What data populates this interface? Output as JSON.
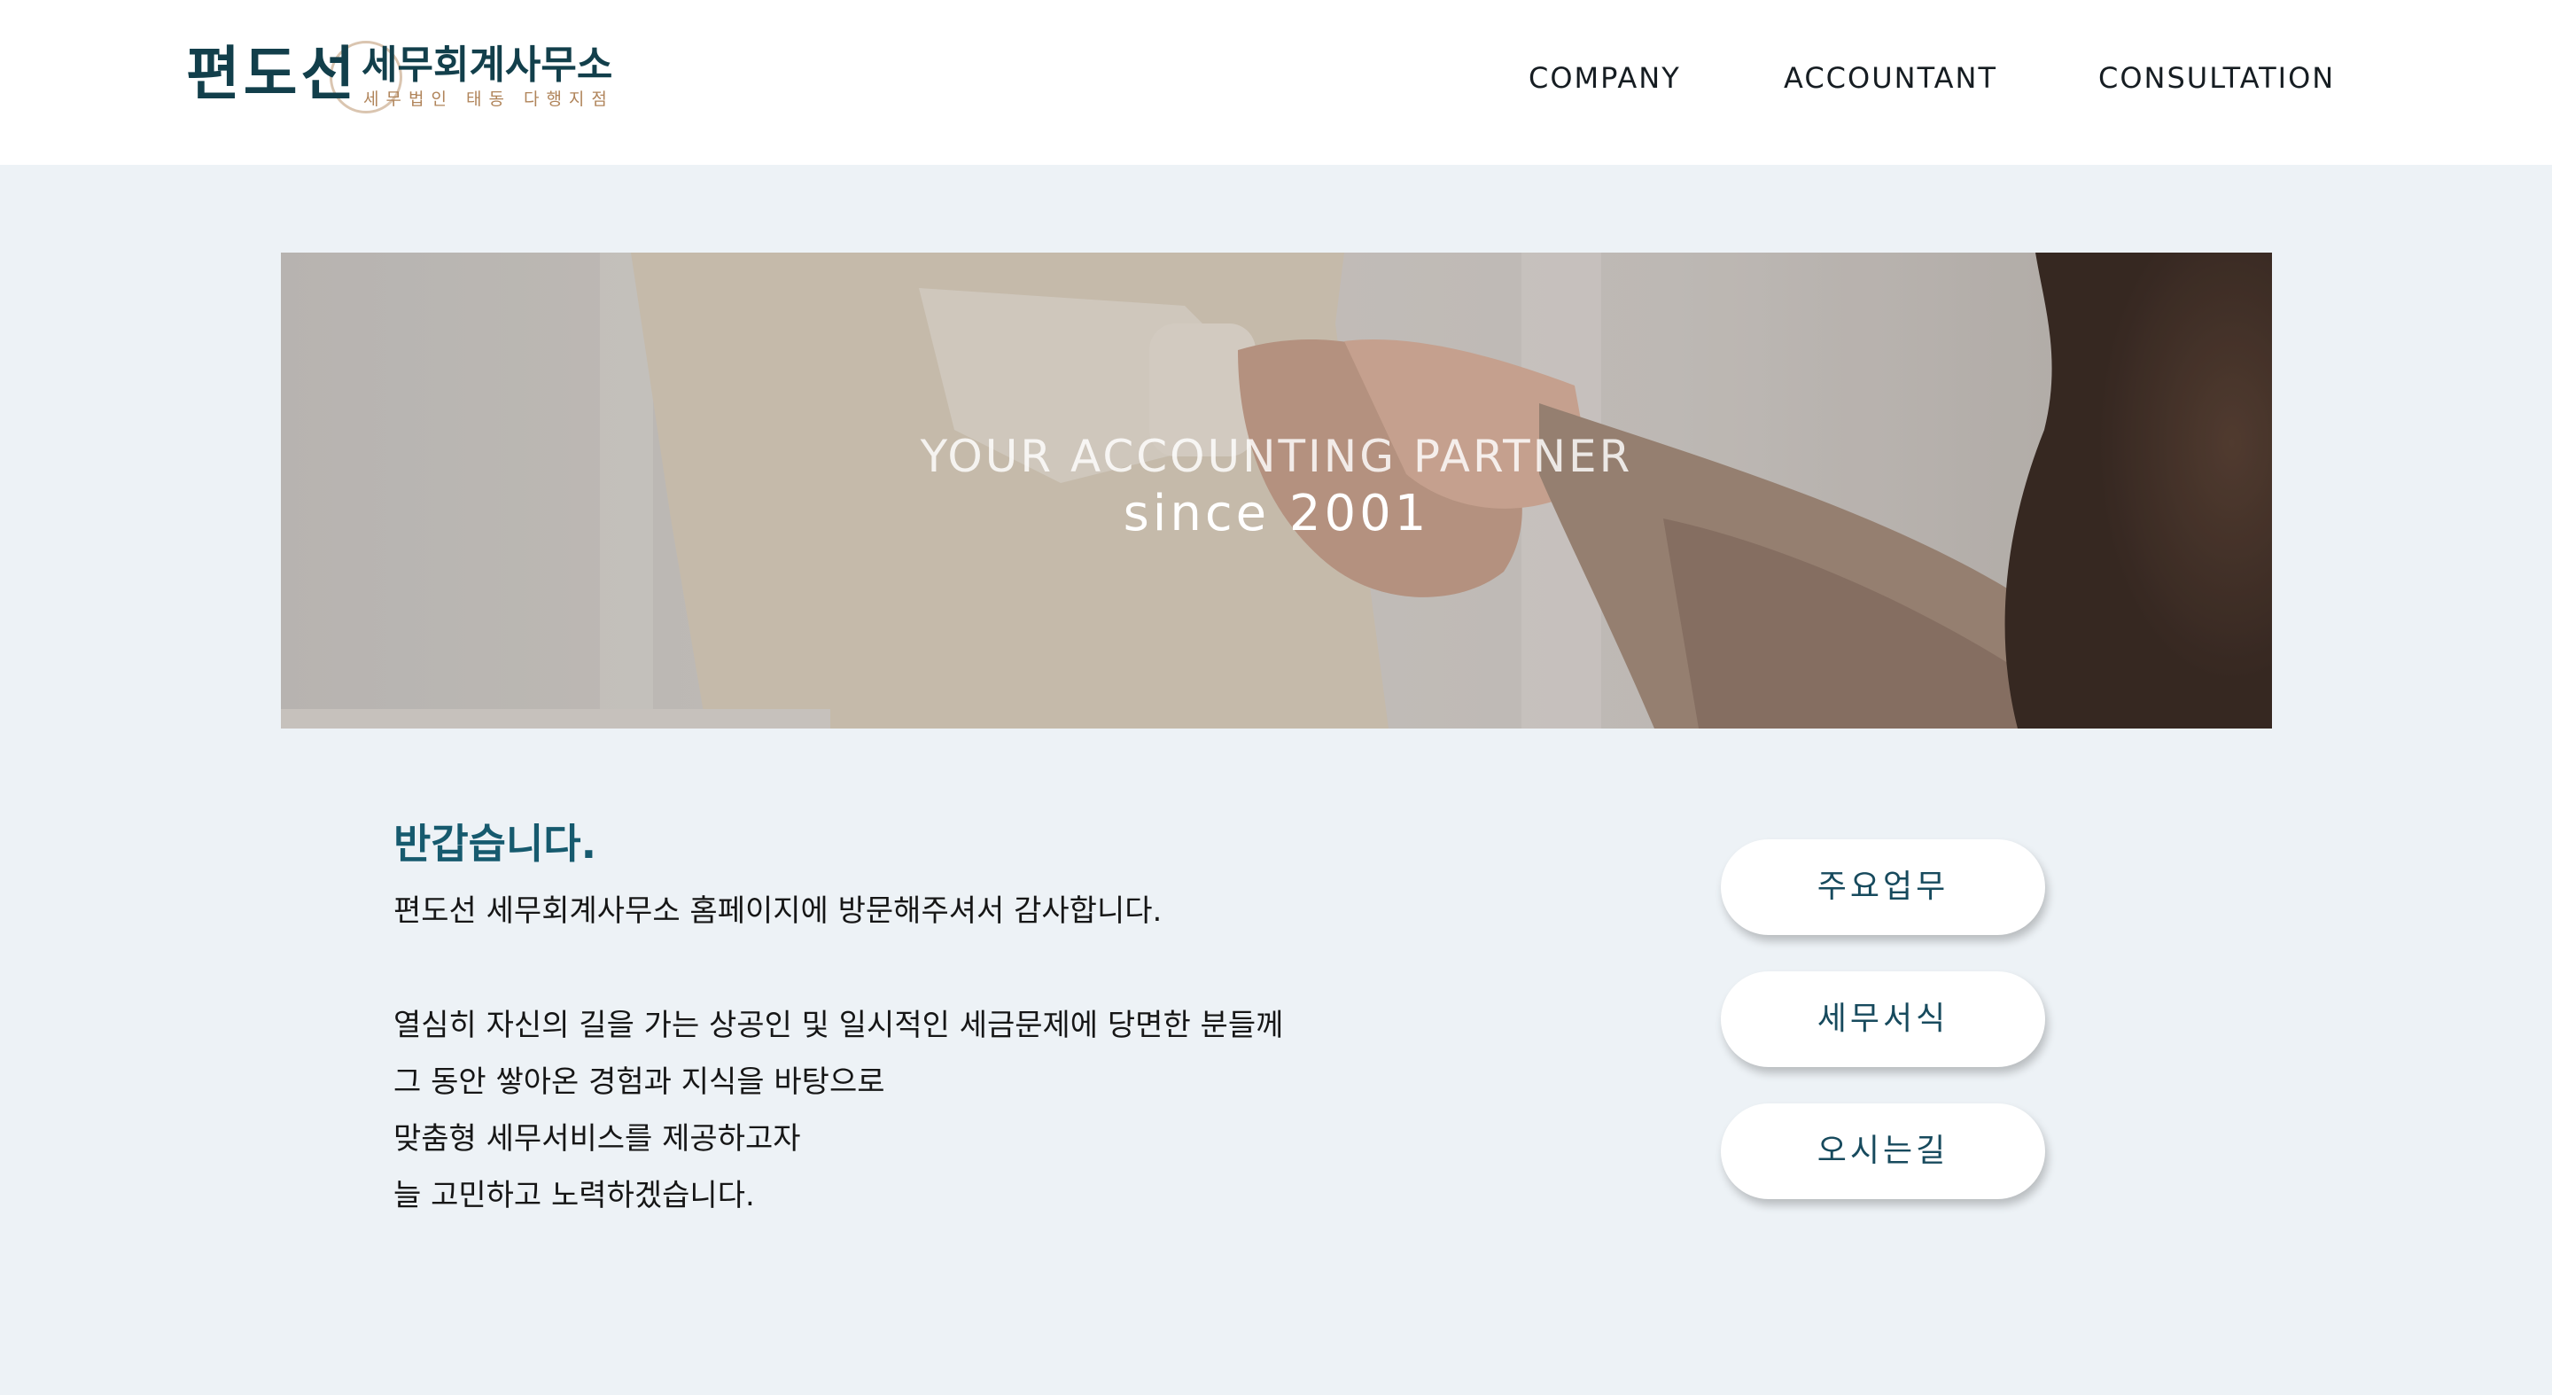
{
  "logo": {
    "name": "편도선",
    "office": "세무회계사무소",
    "subtitle": "세무법인 태동 다행지점"
  },
  "nav": {
    "items": [
      "COMPANY",
      "ACCOUNTANT",
      "CONSULTATION"
    ]
  },
  "hero": {
    "title": "YOUR ACCOUNTING PARTNER",
    "since": "since 2001"
  },
  "intro": {
    "greeting": "반갑습니다.",
    "lines": [
      "편도선 세무회계사무소 홈페이지에 방문해주셔서 감사합니다.",
      "열심히 자신의 길을 가는 상공인 및 일시적인 세금문제에 당면한 분들께",
      "그 동안 쌓아온 경험과 지식을 바탕으로",
      "맞춤형 세무서비스를 제공하고자",
      "늘 고민하고 노력하겠습니다."
    ]
  },
  "buttons": [
    "주요업무",
    "세무서식",
    "오시는길"
  ],
  "colors": {
    "brand": "#123f4b",
    "accent": "#165a6e",
    "gold": "#b0845a",
    "page_bg": "#edf2f6"
  }
}
